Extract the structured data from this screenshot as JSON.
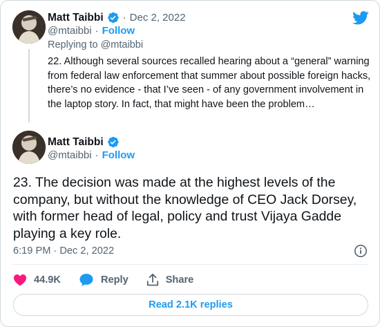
{
  "colors": {
    "brand_blue": "#1d9bf0",
    "text_primary": "#0f1419",
    "text_secondary": "#536471",
    "like_pink": "#f91880",
    "border": "#cfd9de"
  },
  "header": {
    "logo_icon": "twitter-bird-icon"
  },
  "reply_tweet": {
    "author_name": "Matt Taibbi",
    "verified_icon": "verified-badge-icon",
    "separator": "·",
    "date": "Dec 2, 2022",
    "handle": "@mtaibbi",
    "follow_label": "Follow",
    "replying_prefix": "Replying to",
    "replying_handle": "@mtaibbi",
    "text": "22. Although several sources recalled hearing about a “general” warning from federal law enforcement that summer about possible foreign hacks, there’s no evidence - that I’ve seen - of any government involvement in the laptop story. In fact, that might have been the problem…"
  },
  "main_tweet": {
    "author_name": "Matt Taibbi",
    "verified_icon": "verified-badge-icon",
    "handle": "@mtaibbi",
    "separator": "·",
    "follow_label": "Follow",
    "text": "23. The decision was made at the highest levels of the company, but without the knowledge of CEO Jack Dorsey, with former head of legal, policy and trust Vijaya Gadde playing a key role.",
    "time": "6:19 PM",
    "time_separator": "·",
    "date": "Dec 2, 2022",
    "info_icon": "info-icon"
  },
  "actions": {
    "like_count": "44.9K",
    "like_icon": "heart-icon",
    "reply_label": "Reply",
    "reply_icon": "speech-bubble-icon",
    "share_label": "Share",
    "share_icon": "share-upload-icon"
  },
  "read_replies_label": "Read 2.1K replies"
}
